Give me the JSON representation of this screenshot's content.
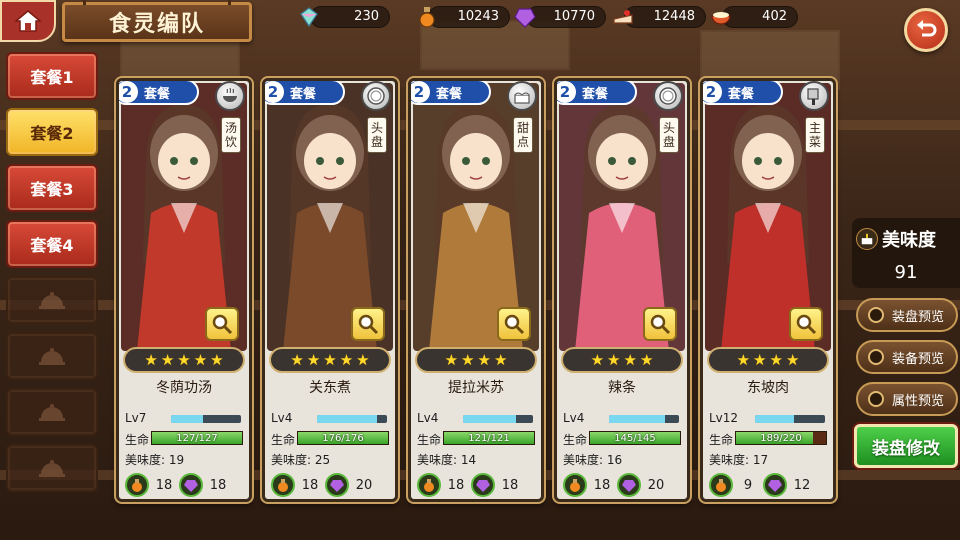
{
  "header": {
    "title": "食灵编队",
    "resources": [
      {
        "icon": "rainbow-crystal-icon",
        "value": "230"
      },
      {
        "icon": "potion-icon",
        "value": "10243"
      },
      {
        "icon": "purple-gem-icon",
        "value": "10770"
      },
      {
        "icon": "cake-slice-icon",
        "value": "12448"
      },
      {
        "icon": "rice-bowl-icon",
        "value": "402"
      }
    ]
  },
  "tabs": [
    {
      "label": "套餐1",
      "state": "normal"
    },
    {
      "label": "套餐2",
      "state": "active"
    },
    {
      "label": "套餐3",
      "state": "normal"
    },
    {
      "label": "套餐4",
      "state": "normal"
    },
    {
      "label": "",
      "state": "locked"
    },
    {
      "label": "",
      "state": "locked"
    },
    {
      "label": "",
      "state": "locked"
    },
    {
      "label": "",
      "state": "locked"
    }
  ],
  "cards": [
    {
      "set_num": "2",
      "set_label": "套餐",
      "type_icon": "soup-bowl-icon",
      "type_tag": "汤饮",
      "stars": 5,
      "name": "冬荫功汤",
      "level": "Lv7",
      "level_pct": 0.45,
      "hp_label": "生命",
      "hp_text": "127/127",
      "hp_pct": 1.0,
      "taste_text": "美味度: 19",
      "res1": "18",
      "res2": "18",
      "theme": "#c0392b"
    },
    {
      "set_num": "2",
      "set_label": "套餐",
      "type_icon": "plate-icon",
      "type_tag": "头盘",
      "stars": 5,
      "name": "关东煮",
      "level": "Lv4",
      "level_pct": 0.85,
      "hp_label": "生命",
      "hp_text": "176/176",
      "hp_pct": 1.0,
      "taste_text": "美味度: 25",
      "res1": "18",
      "res2": "20",
      "theme": "#7a4a2a"
    },
    {
      "set_num": "2",
      "set_label": "套餐",
      "type_icon": "dessert-cake-icon",
      "type_tag": "甜点",
      "stars": 4,
      "name": "提拉米苏",
      "level": "Lv4",
      "level_pct": 0.75,
      "hp_label": "生命",
      "hp_text": "121/121",
      "hp_pct": 1.0,
      "taste_text": "美味度: 14",
      "res1": "18",
      "res2": "18",
      "theme": "#b07a3a"
    },
    {
      "set_num": "2",
      "set_label": "套餐",
      "type_icon": "plate-icon",
      "type_tag": "头盘",
      "stars": 4,
      "name": "辣条",
      "level": "Lv4",
      "level_pct": 0.8,
      "hp_label": "生命",
      "hp_text": "145/145",
      "hp_pct": 1.0,
      "taste_text": "美味度: 16",
      "res1": "18",
      "res2": "20",
      "theme": "#e0607a"
    },
    {
      "set_num": "2",
      "set_label": "套餐",
      "type_icon": "cleaver-icon",
      "type_tag": "主菜",
      "stars": 4,
      "name": "东坡肉",
      "level": "Lv12",
      "level_pct": 0.55,
      "hp_label": "生命",
      "hp_text": "189/220",
      "hp_pct": 0.86,
      "taste_text": "美味度: 17",
      "res1": "9",
      "res2": "12",
      "theme": "#c0302a"
    }
  ],
  "lv_label_unused": "",
  "side": {
    "taste_label": "美味度",
    "taste_value": "91",
    "buttons": [
      "装盘预览",
      "装备预览",
      "属性预览"
    ],
    "edit_label": "装盘修改"
  }
}
